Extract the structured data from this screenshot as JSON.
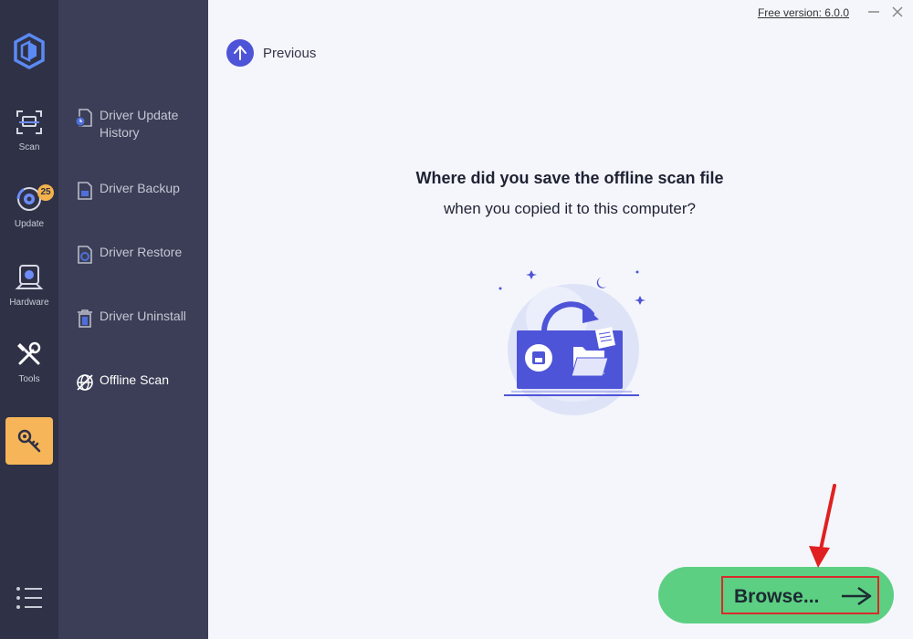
{
  "app": {
    "version_label": "Free version: 6.0.0"
  },
  "rail": {
    "items": [
      {
        "label": "Scan",
        "icon": "scan-icon"
      },
      {
        "label": "Update",
        "icon": "update-icon",
        "badge": "25"
      },
      {
        "label": "Hardware",
        "icon": "hardware-icon"
      },
      {
        "label": "Tools",
        "icon": "tools-icon"
      }
    ],
    "active_icon": "key-icon",
    "menu_icon": "menu-list-icon"
  },
  "sidenav": {
    "items": [
      {
        "label": "Driver Update History",
        "icon": "driver-history-icon"
      },
      {
        "label": "Driver Backup",
        "icon": "driver-backup-icon"
      },
      {
        "label": "Driver Restore",
        "icon": "driver-restore-icon"
      },
      {
        "label": "Driver Uninstall",
        "icon": "trash-icon"
      },
      {
        "label": "Offline Scan",
        "icon": "offline-scan-icon",
        "active": true
      }
    ]
  },
  "main": {
    "previous_label": "Previous",
    "question_line1": "Where did you save the offline scan file",
    "question_line2": "when you copied it to this computer?",
    "browse_label": "Browse..."
  },
  "colors": {
    "rail_bg": "#2f3146",
    "sidenav_bg": "#3b3e56",
    "accent_orange": "#f5b558",
    "accent_blue": "#4e54d8",
    "browse_green": "#5ccf82",
    "highlight_red": "#d92a2a"
  }
}
